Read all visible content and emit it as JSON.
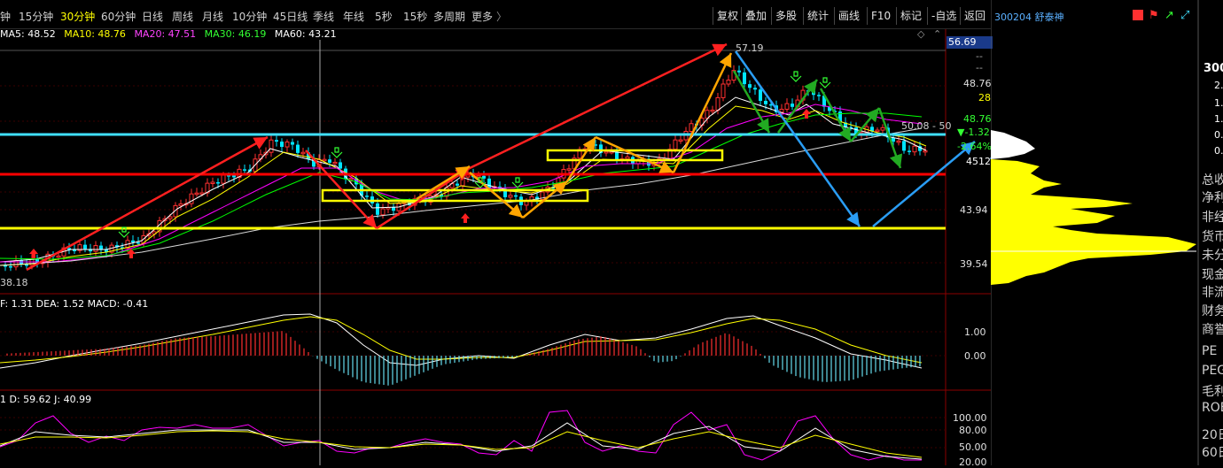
{
  "toolbar": {
    "periods": [
      "钟",
      "15分钟",
      "30分钟",
      "60分钟",
      "日线",
      "周线",
      "月线",
      "10分钟",
      "45日线",
      "季线",
      "年线",
      "5秒",
      "15秒",
      "多周期",
      "更多"
    ],
    "more_arrow": "〉",
    "active_period": "30分钟",
    "actions": [
      "复权",
      "叠加",
      "多股",
      "统计",
      "画线",
      "F10",
      "标记",
      "-自选",
      "返回"
    ]
  },
  "stock": {
    "code": "300204",
    "name": "舒泰神"
  },
  "ma_legend": [
    {
      "label": "MA5: 48.52",
      "color": "#ffffff"
    },
    {
      "label": "MA10: 48.76",
      "color": "#ffff00"
    },
    {
      "label": "MA20: 47.51",
      "color": "#ff00ff"
    },
    {
      "label": "MA30: 46.19",
      "color": "#00ff00"
    },
    {
      "label": "MA60: 43.21",
      "color": "#ffffff"
    }
  ],
  "price_axis": {
    "current_price_badge": "56.69",
    "labels": [
      "--",
      "--",
      "48.76",
      "28",
      "48.76",
      "▼-1.32",
      "-2.64%",
      "4512",
      "43.94",
      "39.54"
    ]
  },
  "annotations": {
    "high": "57.19",
    "low": "38.18",
    "right_value": "50.08 - 50"
  },
  "macd": {
    "legend": "F: 1.31  DEA: 1.52  MACD: -0.41",
    "axis": [
      "1.00",
      "0.00"
    ]
  },
  "kdj": {
    "legend": "1  D: 59.62  J: 40.99",
    "axis": [
      "100.00",
      "80.00",
      "50.00",
      "20.00"
    ]
  },
  "right_panel": {
    "header": "300",
    "numbers": [
      "2.",
      "1.",
      "1.",
      "0.",
      "0."
    ],
    "side_labels": [
      "总收",
      "净利",
      "非经",
      "货币",
      "未分",
      "现金",
      "非流",
      "财务",
      "商誉",
      "PE",
      "PEG",
      "毛利",
      "ROE",
      "20日",
      "60日"
    ]
  },
  "colors": {
    "up": "#ff3030",
    "down": "#00ffff",
    "cyan_line": "#40e0ff",
    "red_line": "#ff0000",
    "yellow_line": "#ffff00"
  }
}
